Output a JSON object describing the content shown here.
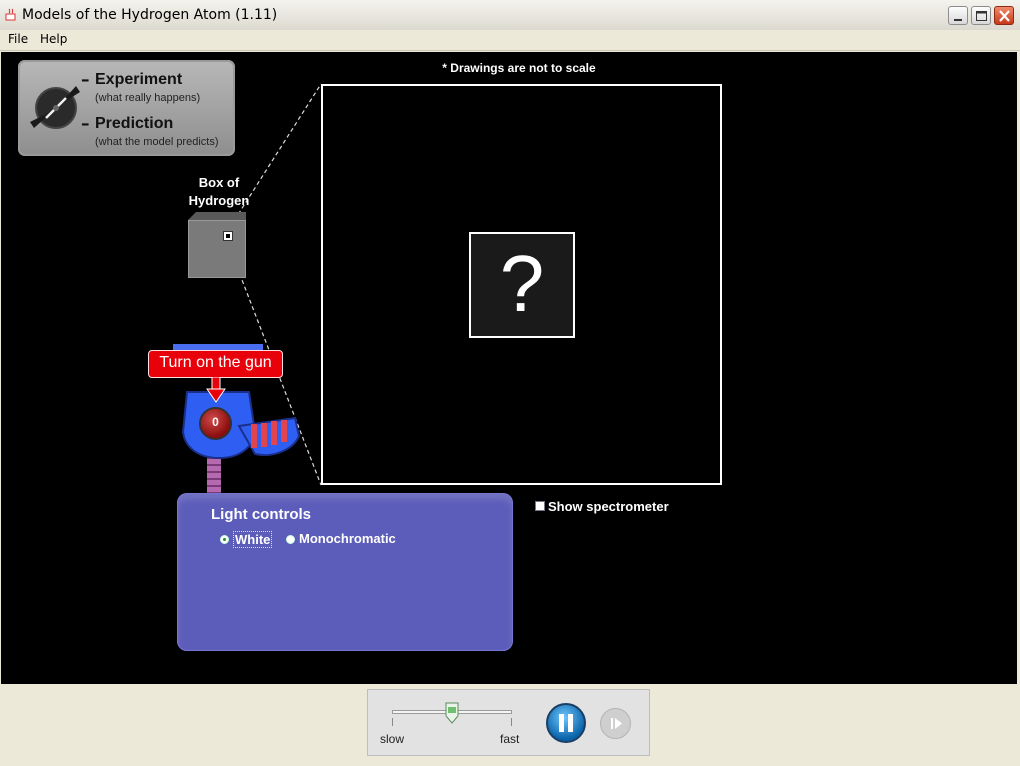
{
  "window": {
    "title": "Models of the Hydrogen Atom (1.11)"
  },
  "menu": {
    "items": [
      "File",
      "Help"
    ]
  },
  "mode_panel": {
    "experiment_label": "Experiment",
    "experiment_sub": "(what really happens)",
    "prediction_label": "Prediction",
    "prediction_sub": "(what the model predicts)",
    "selected": "Experiment"
  },
  "box": {
    "label_line1": "Box of",
    "label_line2": "Hydrogen"
  },
  "scale_note": "* Drawings are not to scale",
  "zoom_view": {
    "placeholder": "?"
  },
  "gun": {
    "tooltip": "Turn on the gun",
    "button_label": "0"
  },
  "light_controls": {
    "title": "Light controls",
    "options": [
      "White",
      "Monochromatic"
    ],
    "selected": "White"
  },
  "spectrometer": {
    "label": "Show spectrometer",
    "checked": false
  },
  "clock": {
    "slow_label": "slow",
    "fast_label": "fast",
    "speed": 0.5,
    "state": "running"
  },
  "colors": {
    "stage": "#000000",
    "light_panel": "#5c5cba",
    "tooltip": "#e8000a",
    "pause_button": "#1b7fd0"
  }
}
